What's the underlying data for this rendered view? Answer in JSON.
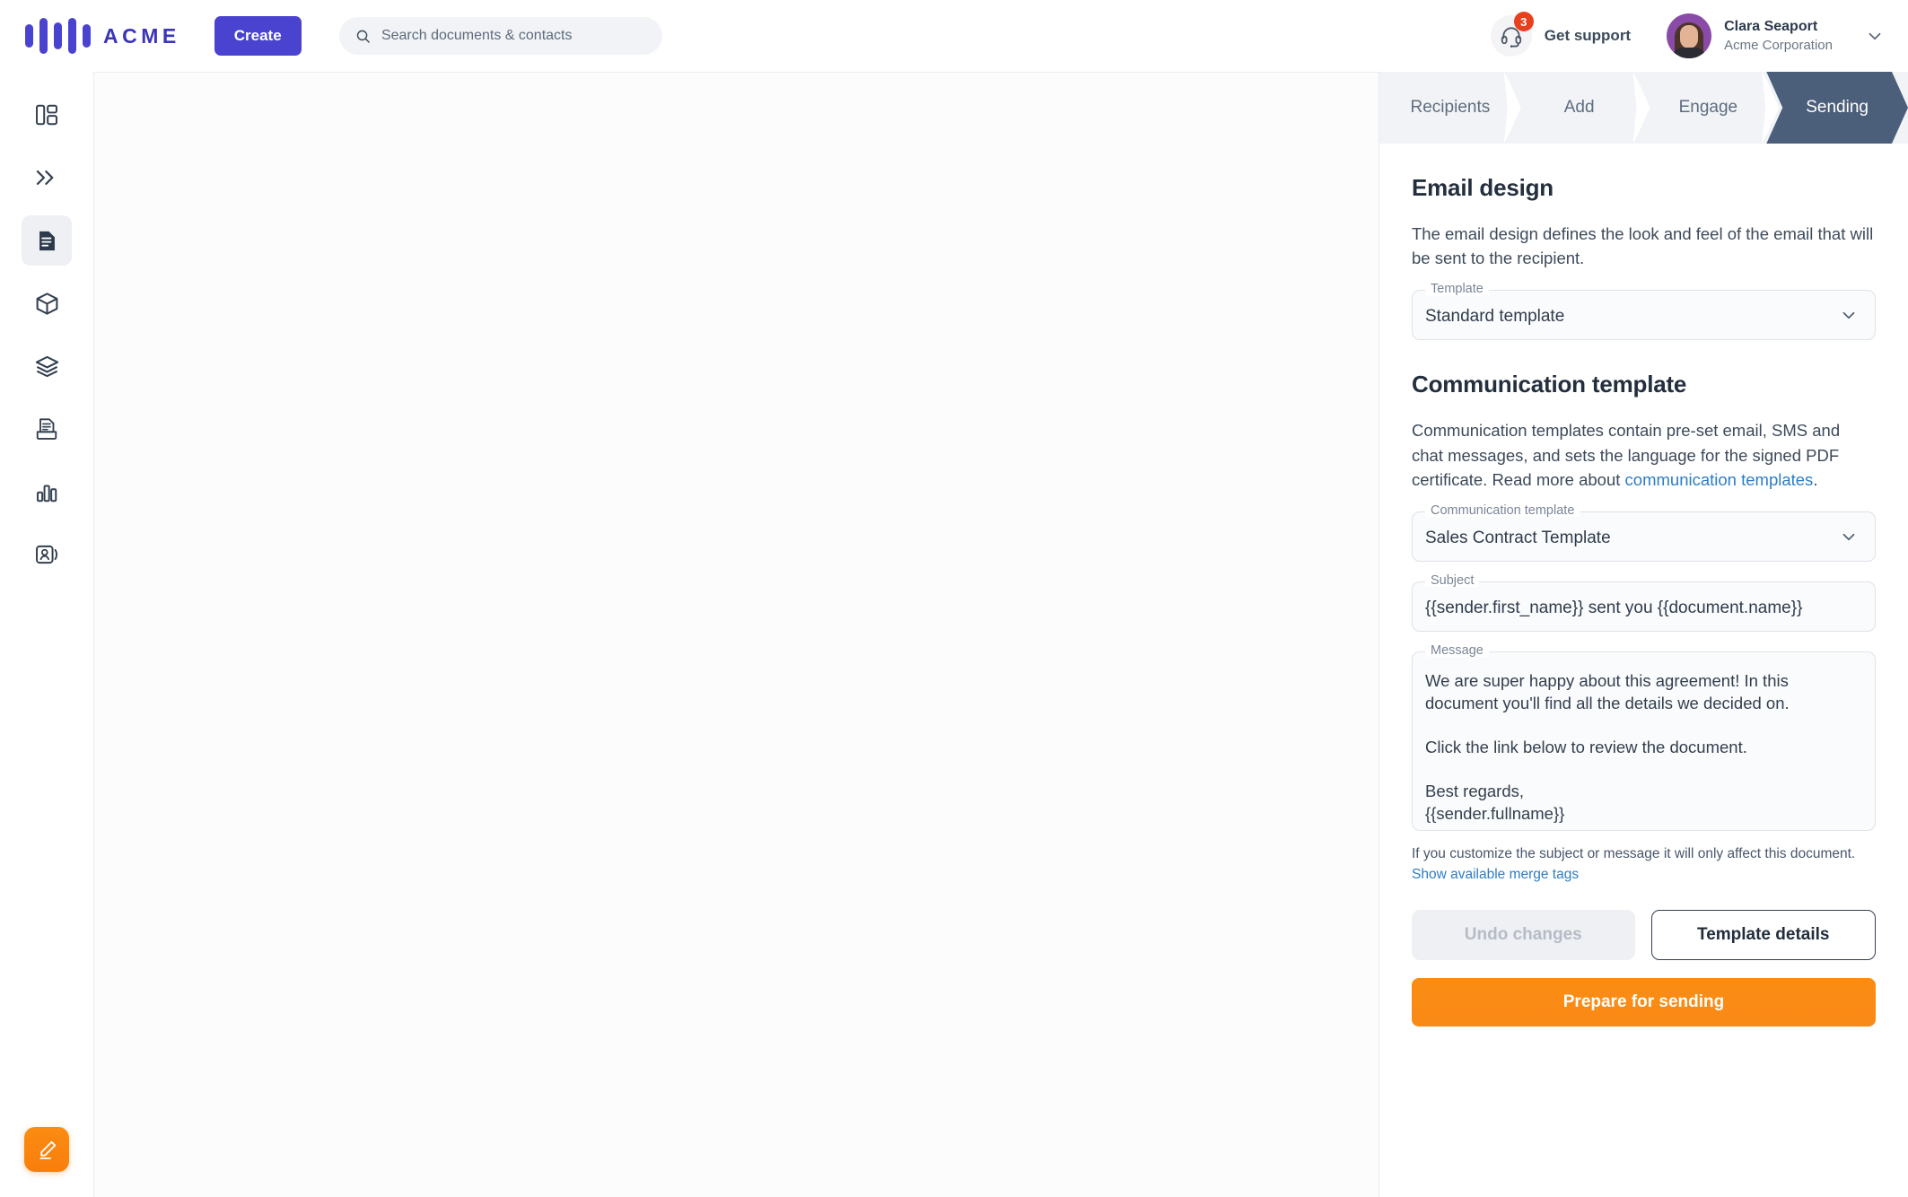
{
  "brand": {
    "name": "ACME",
    "logo_color": "#4a43cf"
  },
  "topbar": {
    "create_label": "Create",
    "search": {
      "placeholder": "Search documents & contacts",
      "value": ""
    },
    "support": {
      "label": "Get support",
      "badge_count": "3",
      "badge_color": "#e8401f"
    },
    "user": {
      "name": "Clara Seaport",
      "organization": "Acme Corporation"
    }
  },
  "sidebar": {
    "items": [
      {
        "icon": "dashboard-icon",
        "active": false
      },
      {
        "icon": "workflow-chevrons-icon",
        "active": false
      },
      {
        "icon": "document-icon",
        "active": true
      },
      {
        "icon": "package-box-icon",
        "active": false
      },
      {
        "icon": "layers-icon",
        "active": false
      },
      {
        "icon": "inbox-icon",
        "active": false
      },
      {
        "icon": "bar-chart-icon",
        "active": false
      },
      {
        "icon": "contacts-icon",
        "active": false
      }
    ],
    "fab": {
      "icon": "pencil-edit-icon",
      "color": "#f97e0c"
    }
  },
  "panel": {
    "steps": [
      {
        "label": "Recipients",
        "current": false
      },
      {
        "label": "Add",
        "current": false
      },
      {
        "label": "Engage",
        "current": false
      },
      {
        "label": "Sending",
        "current": true
      }
    ],
    "email_design": {
      "title": "Email design",
      "description": "The email design defines the look and feel of the email that will be sent to the recipient.",
      "template_field": {
        "label": "Template",
        "value": "Standard template"
      }
    },
    "communication_template": {
      "title": "Communication template",
      "description_before_link": "Communication templates contain pre-set email, SMS and chat messages, and sets the language for the signed PDF certificate. Read more about ",
      "link_text": "communication templates",
      "description_after_link": ".",
      "template_field": {
        "label": "Communication template",
        "value": "Sales Contract Template"
      },
      "subject_field": {
        "label": "Subject",
        "value": "{{sender.first_name}} sent you {{document.name}}"
      },
      "message_field": {
        "label": "Message",
        "value": "We are super happy about this agreement! In this document you'll find all the details we decided on.\n\nClick the link below to review the document.\n\nBest regards,\n{{sender.fullname}}"
      },
      "hint_text": "If you customize the subject or message it will only affect this document. ",
      "hint_link": "Show available merge tags"
    },
    "actions": {
      "undo_label": "Undo changes",
      "template_details_label": "Template details",
      "prepare_label": "Prepare for sending",
      "prepare_color": "#f98a16"
    }
  }
}
